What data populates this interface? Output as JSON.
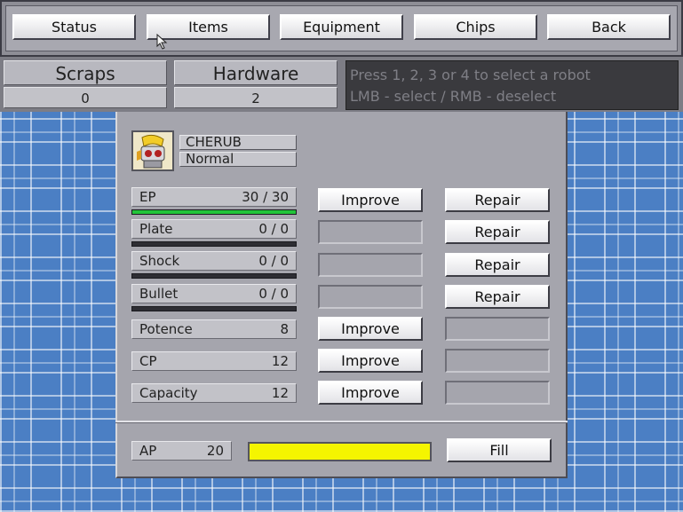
{
  "nav": {
    "tabs": [
      {
        "label": "Status"
      },
      {
        "label": "Items"
      },
      {
        "label": "Equipment"
      },
      {
        "label": "Chips"
      },
      {
        "label": "Back"
      }
    ]
  },
  "resources": {
    "scraps_label": "Scraps",
    "scraps_value": "0",
    "hardware_label": "Hardware",
    "hardware_value": "2"
  },
  "hint": {
    "line1": "Press 1, 2, 3 or 4 to select a robot",
    "line2": "LMB - select / RMB - deselect"
  },
  "robot": {
    "name": "CHERUB",
    "state": "Normal",
    "icon": "robot-portrait-icon"
  },
  "stats": {
    "ep": {
      "label": "EP",
      "value": "30 / 30",
      "fill": 1.0,
      "improve": "Improve",
      "repair": "Repair"
    },
    "plate": {
      "label": "Plate",
      "value": "0 / 0",
      "fill": 0,
      "repair": "Repair"
    },
    "shock": {
      "label": "Shock",
      "value": "0 / 0",
      "fill": 0,
      "repair": "Repair"
    },
    "bullet": {
      "label": "Bullet",
      "value": "0 / 0",
      "fill": 0,
      "repair": "Repair"
    },
    "potence": {
      "label": "Potence",
      "value": "8",
      "improve": "Improve"
    },
    "cp": {
      "label": "CP",
      "value": "12",
      "improve": "Improve"
    },
    "capacity": {
      "label": "Capacity",
      "value": "12",
      "improve": "Improve"
    }
  },
  "ap": {
    "label": "AP",
    "value": "20",
    "fill_fraction": 1.0,
    "fill_button": "Fill"
  },
  "colors": {
    "ep_bar": "#22c43a",
    "ap_bar": "#f5f500",
    "background": "#4b7fc4"
  }
}
